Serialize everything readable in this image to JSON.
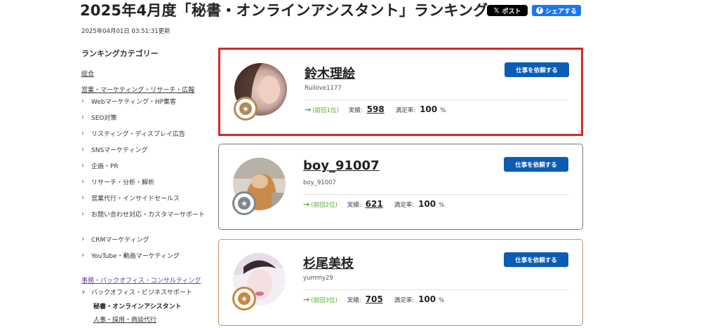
{
  "header": {
    "title": "2025年4月度「秘書・オンラインアシスタント」ランキング",
    "share_x": "ポスト",
    "share_fb": "シェアする",
    "updated": "2025年04月01日 03:51:31更新"
  },
  "sidebar": {
    "title": "ランキングカテゴリー",
    "overall": "総合",
    "group1": "営業・マーケティング・リサーチ・広報",
    "items": [
      "Webマーケティング・HP集客",
      "SEO対策",
      "リスティング・ディスプレイ広告",
      "SNSマーケティング",
      "企画・PR",
      "リサーチ・分析・解析",
      "営業代行・インサイドセールス",
      "お問い合わせ対応・カスタマーサポート",
      "CRMマーケティング",
      "YouTube・動画マーケティング"
    ],
    "group2": "事務・バックオフィス・コンサルティング",
    "expanded_item": "バックオフィス・ビジネスサポート",
    "current": "秘書・オンラインアシスタント",
    "next": "人事・採用・商談代行"
  },
  "rankings": [
    {
      "name": "鈴木理絵",
      "user_id": "Ruilove1177",
      "previous": "(前回1位)",
      "jobs_label": "実績:",
      "jobs": "598",
      "satisfaction_label": "満足率:",
      "satisfaction": "100",
      "unit": "%",
      "button": "仕事を依頼する",
      "medal": "gold"
    },
    {
      "name": "boy_91007",
      "user_id": "boy_91007",
      "previous": "(前回2位)",
      "jobs_label": "実績:",
      "jobs": "621",
      "satisfaction_label": "満足率:",
      "satisfaction": "100",
      "unit": "%",
      "button": "仕事を依頼する",
      "medal": "silver"
    },
    {
      "name": "杉尾美枝",
      "user_id": "yummy29",
      "previous": "(前回3位)",
      "jobs_label": "実績:",
      "jobs": "705",
      "satisfaction_label": "満足率:",
      "satisfaction": "100",
      "unit": "%",
      "button": "仕事を依頼する",
      "medal": "bronze"
    }
  ],
  "colors": {
    "highlight_border": "#d62828",
    "button_blue": "#0b5cb5",
    "rank_green": "#58a832",
    "sidebar_purple": "#6b3aa6"
  }
}
